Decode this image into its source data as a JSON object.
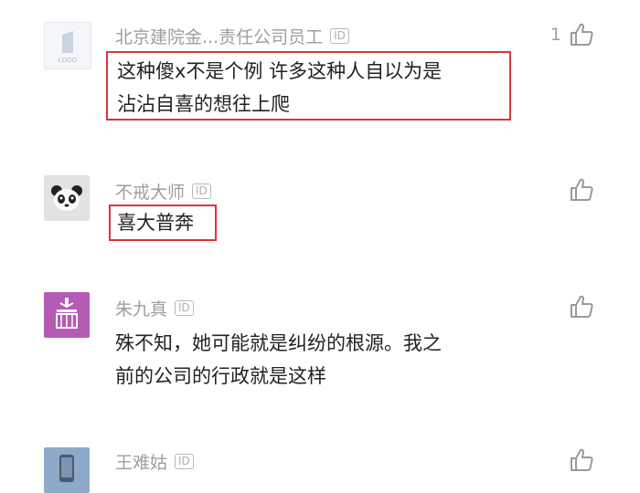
{
  "comments": [
    {
      "username": "北京建院金...责任公司员工",
      "id_badge": "ID",
      "text_lines": [
        "这种傻x不是个例 许多这种人自以为是",
        "沾沾自喜的想往上爬"
      ],
      "likes": "1",
      "avatar_label": "LOGO",
      "highlighted": true
    },
    {
      "username": "不戒大师",
      "id_badge": "ID",
      "text_lines": [
        "喜大普奔"
      ],
      "likes": "",
      "highlighted": true
    },
    {
      "username": "朱九真",
      "id_badge": "ID",
      "text_lines": [
        "殊不知，她可能就是纠纷的根源。我之",
        "前的公司的行政就是这样"
      ],
      "likes": "",
      "highlighted": false
    },
    {
      "username": "王难姑",
      "id_badge": "ID",
      "text_lines": [],
      "likes": "",
      "highlighted": false
    }
  ],
  "colors": {
    "highlight_border": "#d9353b",
    "username": "#9e9e9e",
    "text": "#222222",
    "avatar_purple": "#b35bb5",
    "avatar_blue": "#8fa9c9"
  },
  "icons": {
    "like": "thumbs-up-icon",
    "id": "id-badge-icon"
  }
}
